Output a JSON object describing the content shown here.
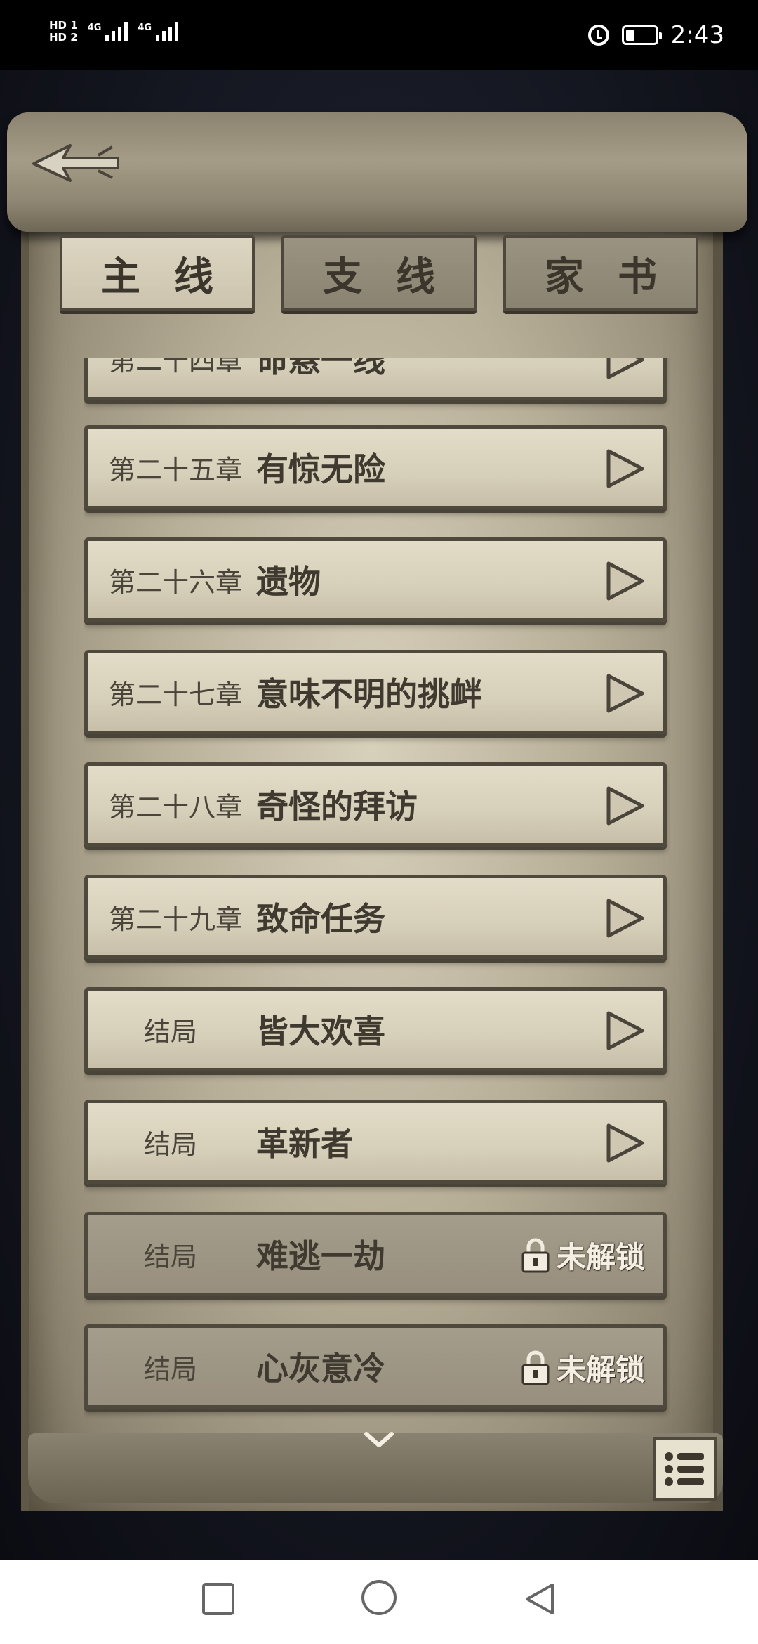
{
  "status_bar": {
    "sim1": "HD 1",
    "sim2": "HD 2",
    "network1": "4G",
    "network2": "4G",
    "time": "2:43",
    "icons": [
      "alarm-icon",
      "battery-icon"
    ]
  },
  "header": {
    "back_icon": "arrow-left-icon"
  },
  "tabs": [
    {
      "label": "主线",
      "active": true
    },
    {
      "label": "支线",
      "active": false
    },
    {
      "label": "家书",
      "active": false
    }
  ],
  "chapters": [
    {
      "chapter": "第二十四章",
      "title": "命悬一线",
      "status": "play"
    },
    {
      "chapter": "第二十五章",
      "title": "有惊无险",
      "status": "play"
    },
    {
      "chapter": "第二十六章",
      "title": "遗物",
      "status": "play"
    },
    {
      "chapter": "第二十七章",
      "title": "意味不明的挑衅",
      "status": "play"
    },
    {
      "chapter": "第二十八章",
      "title": "奇怪的拜访",
      "status": "play"
    },
    {
      "chapter": "第二十九章",
      "title": "致命任务",
      "status": "play"
    },
    {
      "chapter": "结局",
      "title": "皆大欢喜",
      "status": "play"
    },
    {
      "chapter": "结局",
      "title": "革新者",
      "status": "play"
    },
    {
      "chapter": "结局",
      "title": "难逃一劫",
      "status": "locked",
      "lock_label": "未解锁"
    },
    {
      "chapter": "结局",
      "title": "心灰意冷",
      "status": "locked",
      "lock_label": "未解锁"
    }
  ],
  "footer": {
    "more_icon": "chevron-down-icon",
    "menu_icon": "list-icon"
  },
  "navbar": {
    "icons": [
      "square-recent-icon",
      "circle-home-icon",
      "triangle-back-icon"
    ]
  }
}
